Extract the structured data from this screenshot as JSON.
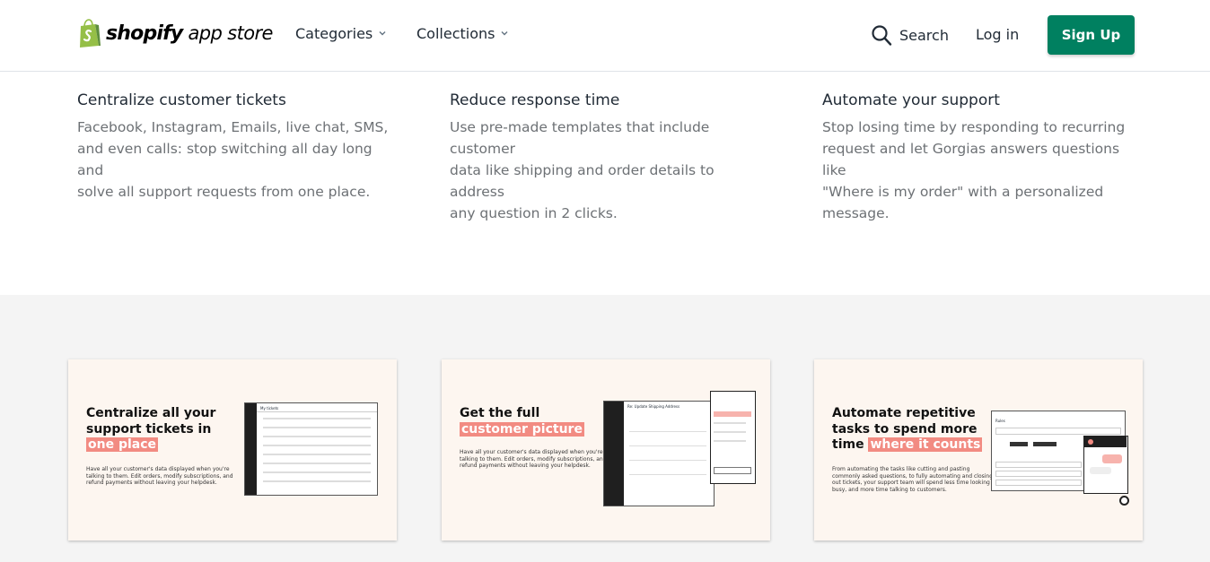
{
  "header": {
    "logo_text": "shopify",
    "logo_sub": "app store",
    "nav": [
      {
        "label": "Categories"
      },
      {
        "label": "Collections"
      }
    ],
    "search_label": "Search",
    "login_label": "Log in",
    "signup_label": "Sign Up"
  },
  "features": [
    {
      "title": "Centralize customer tickets",
      "lines": [
        "Facebook, Instagram, Emails, live chat, SMS,",
        "and even calls: stop switching all day long and",
        "solve all support requests from one place."
      ]
    },
    {
      "title": "Reduce response time",
      "lines": [
        "Use pre-made templates that include customer",
        "data like shipping and order details to address",
        "any question in 2 clicks."
      ]
    },
    {
      "title": "Automate your support",
      "lines": [
        "Stop losing time by responding to recurring",
        "request and let Gorgias answers questions like",
        "\"Where is my order\" with a personalized",
        "message."
      ]
    }
  ],
  "gallery": [
    {
      "title_lines": [
        "Centralize all your",
        "support tickets in"
      ],
      "highlight": "one place",
      "desc_lines": [
        "Have all your customer's data displayed when you're",
        "talking to them. Edit orders, modify subscriptions, and",
        "refund payments without leaving your helpdesk."
      ],
      "mock_header": "My tickets"
    },
    {
      "title_lines": [
        "Get the full"
      ],
      "highlight": "customer picture",
      "desc_lines": [
        "Have all your customer's data displayed when you're",
        "talking to them. Edit orders, modify subscriptions, and",
        "refund payments without leaving your helpdesk."
      ],
      "mock_header": "Re: Update Shipping Address"
    },
    {
      "title_lines": [
        "Automate repetitive",
        "tasks to spend more"
      ],
      "title_prefix": "time ",
      "highlight": "where it counts",
      "desc_lines": [
        "From automating the tasks like cutting and pasting",
        "commonly asked questions, to fully automating and closing",
        "out tickets, your support team will spend less time looking",
        "busy, and more time talking to customers."
      ],
      "mock_header": "Rules"
    }
  ],
  "colors": {
    "brand_green": "#008060",
    "highlight": "#f28b82",
    "gallery_bg": "#f4f4f4",
    "card_bg": "#fdf6f0"
  }
}
